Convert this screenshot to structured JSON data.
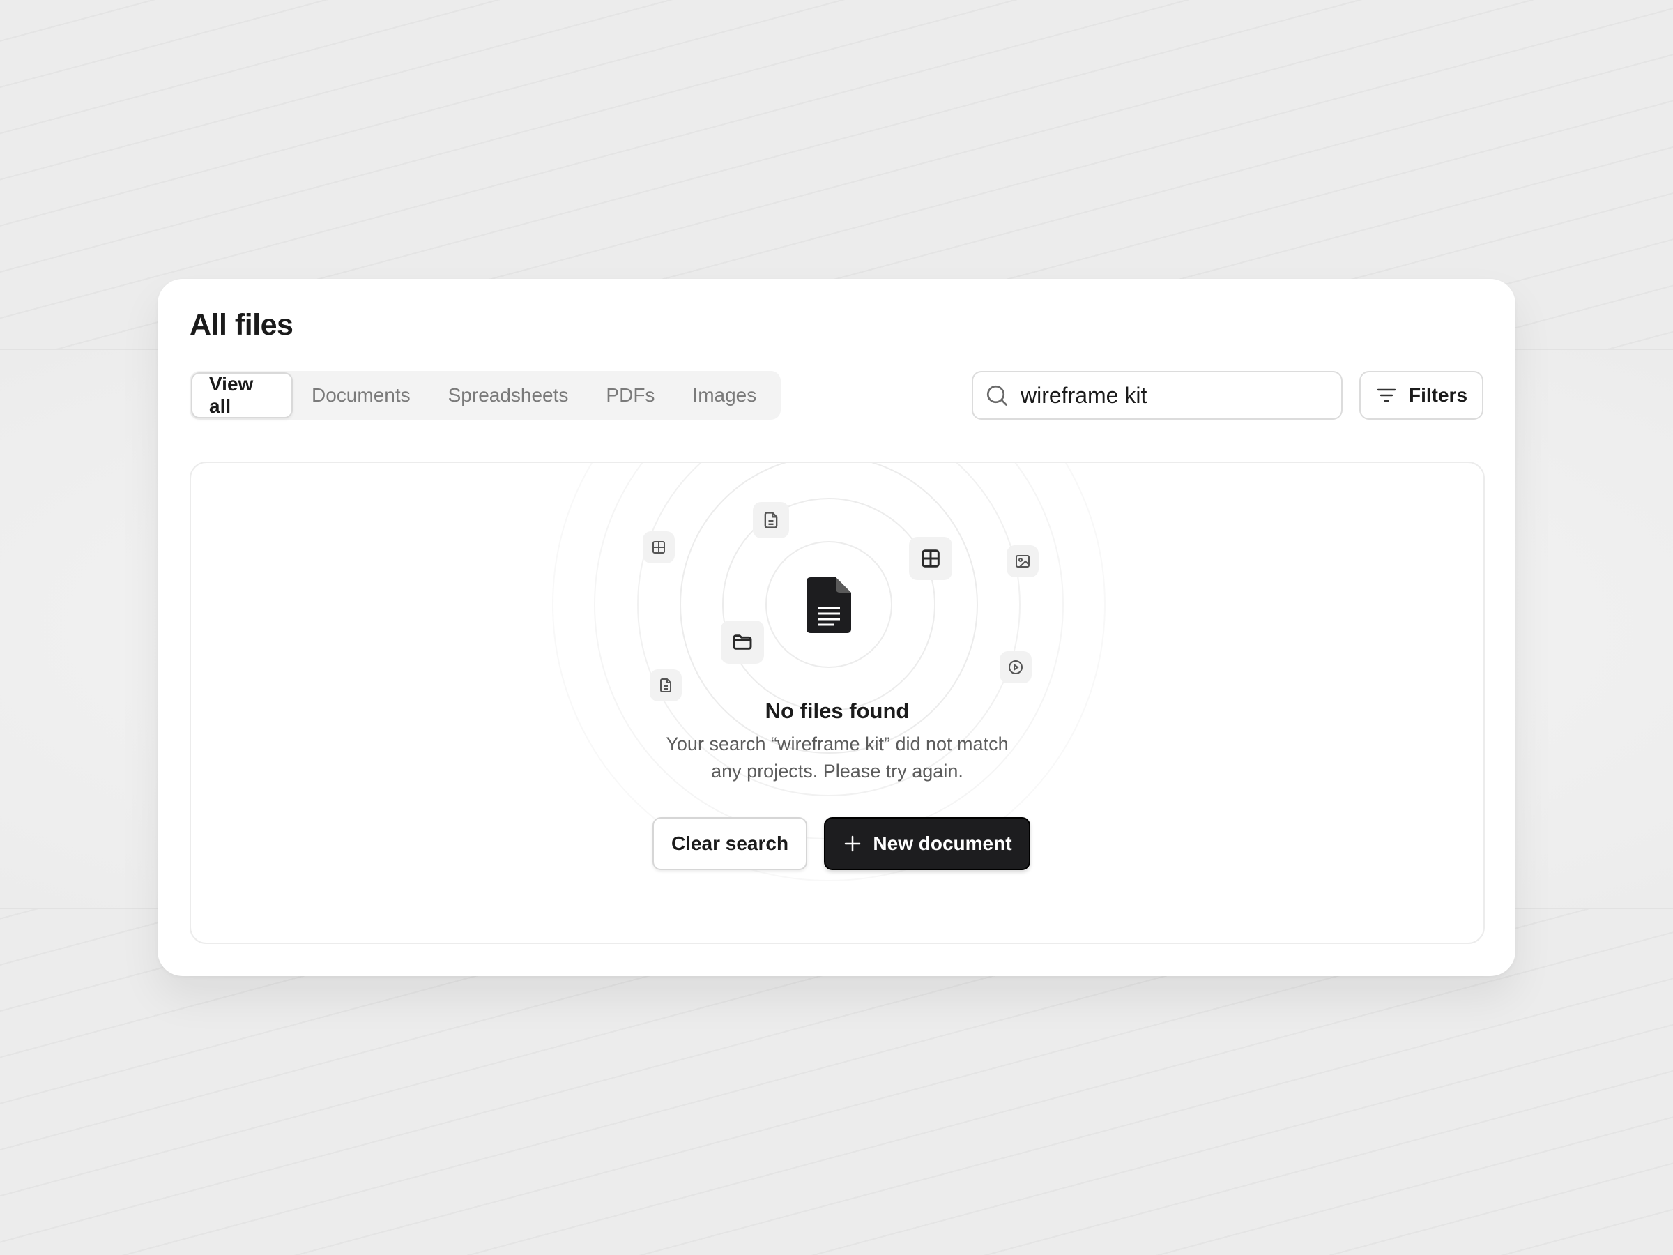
{
  "page": {
    "title": "All files"
  },
  "tabs": [
    {
      "label": "View all",
      "active": true
    },
    {
      "label": "Documents",
      "active": false
    },
    {
      "label": "Spreadsheets",
      "active": false
    },
    {
      "label": "PDFs",
      "active": false
    },
    {
      "label": "Images",
      "active": false
    }
  ],
  "search": {
    "value": "wireframe kit",
    "icon": "search-icon"
  },
  "filters": {
    "label": "Filters",
    "icon": "filter-lines-icon"
  },
  "empty_state": {
    "title": "No files found",
    "message": "Your search “wireframe kit” did not match any projects. Please try again.",
    "icons": [
      "document-icon",
      "table-icon",
      "file-text-icon",
      "grid-icon",
      "image-icon",
      "folder-icon",
      "file-text-icon",
      "play-circle-icon"
    ]
  },
  "actions": {
    "clear_label": "Clear search",
    "new_label": "New document",
    "new_icon": "plus-icon"
  },
  "colors": {
    "primary_button": "#1d1d1f",
    "background": "#ececec",
    "card": "#ffffff"
  }
}
